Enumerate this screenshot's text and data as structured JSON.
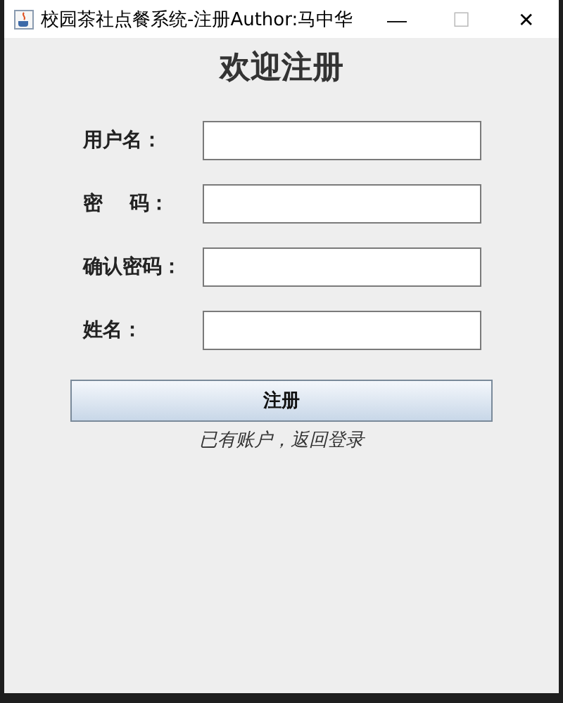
{
  "window": {
    "title": "校园茶社点餐系统-注册Author:马中华",
    "controls": [
      "—",
      "☐",
      "✕"
    ]
  },
  "heading": "欢迎注册",
  "fields": [
    {
      "label": "用户名："
    },
    {
      "label": "密　 码："
    },
    {
      "label": "确认密码："
    },
    {
      "label": "姓名："
    }
  ],
  "submit_button": "注册",
  "login_link": "已有账户，返回登录"
}
